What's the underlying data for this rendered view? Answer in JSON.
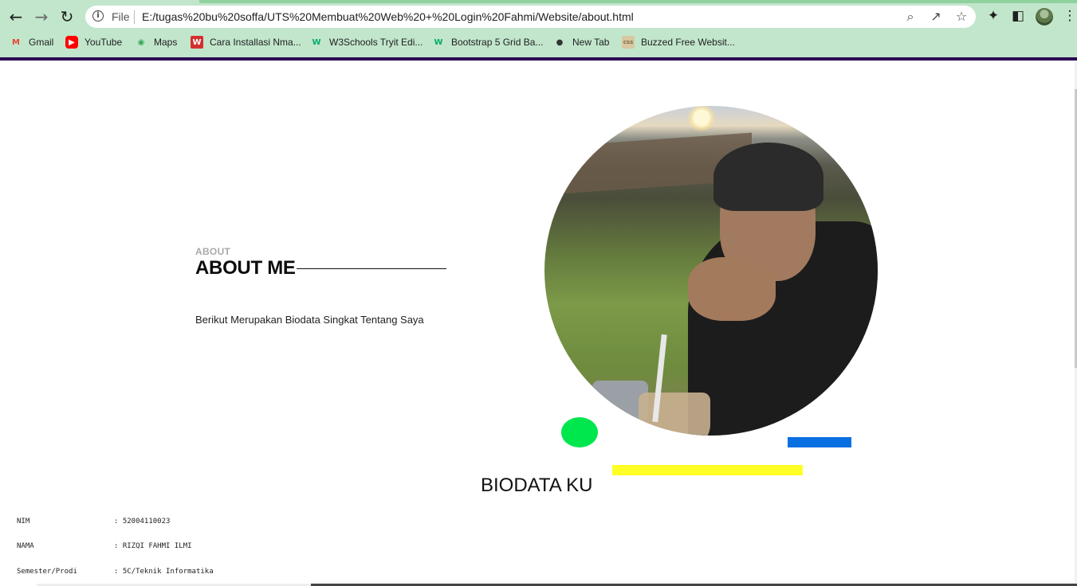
{
  "browser": {
    "scheme_label": "File",
    "url": "E:/tugas%20bu%20soffa/UTS%20Membuat%20Web%20+%20Login%20Fahmi/Website/about.html",
    "bookmarks": [
      {
        "label": "Gmail",
        "icon": "gmail-icon",
        "color": "#ea4335"
      },
      {
        "label": "YouTube",
        "icon": "youtube-icon",
        "color": "#ff0000"
      },
      {
        "label": "Maps",
        "icon": "maps-icon",
        "color": "#34a853"
      },
      {
        "label": "Cara Installasi Nma...",
        "icon": "wa-icon",
        "color": "#d32f2f"
      },
      {
        "label": "W3Schools Tryit Edi...",
        "icon": "w3schools-icon",
        "color": "#04aa6d"
      },
      {
        "label": "Bootstrap 5 Grid Ba...",
        "icon": "w3schools-icon",
        "color": "#04aa6d"
      },
      {
        "label": "New Tab",
        "icon": "globe-icon",
        "color": "#333333"
      },
      {
        "label": "Buzzed Free Websit...",
        "icon": "css-icon",
        "color": "#d9c7a2"
      }
    ]
  },
  "about": {
    "label": "ABOUT",
    "title": "ABOUT ME",
    "description": "Berikut Merupakan Biodata Singkat Tentang Saya"
  },
  "biodata": {
    "title": "BIODATA KU",
    "rows": [
      {
        "key": "NIM",
        "value": ": 52004110023"
      },
      {
        "key": "NAMA",
        "value": ": RIZQI FAHMI ILMI"
      },
      {
        "key": "Semester/Prodi",
        "value": ": 5C/Teknik Informatika"
      }
    ]
  },
  "colors": {
    "chrome": "#c2e6cb",
    "accent_purple": "#2a0254",
    "green_dot": "#00e64d",
    "blue_bar": "#0a6fe0",
    "yellow_bar": "#ffff26"
  }
}
